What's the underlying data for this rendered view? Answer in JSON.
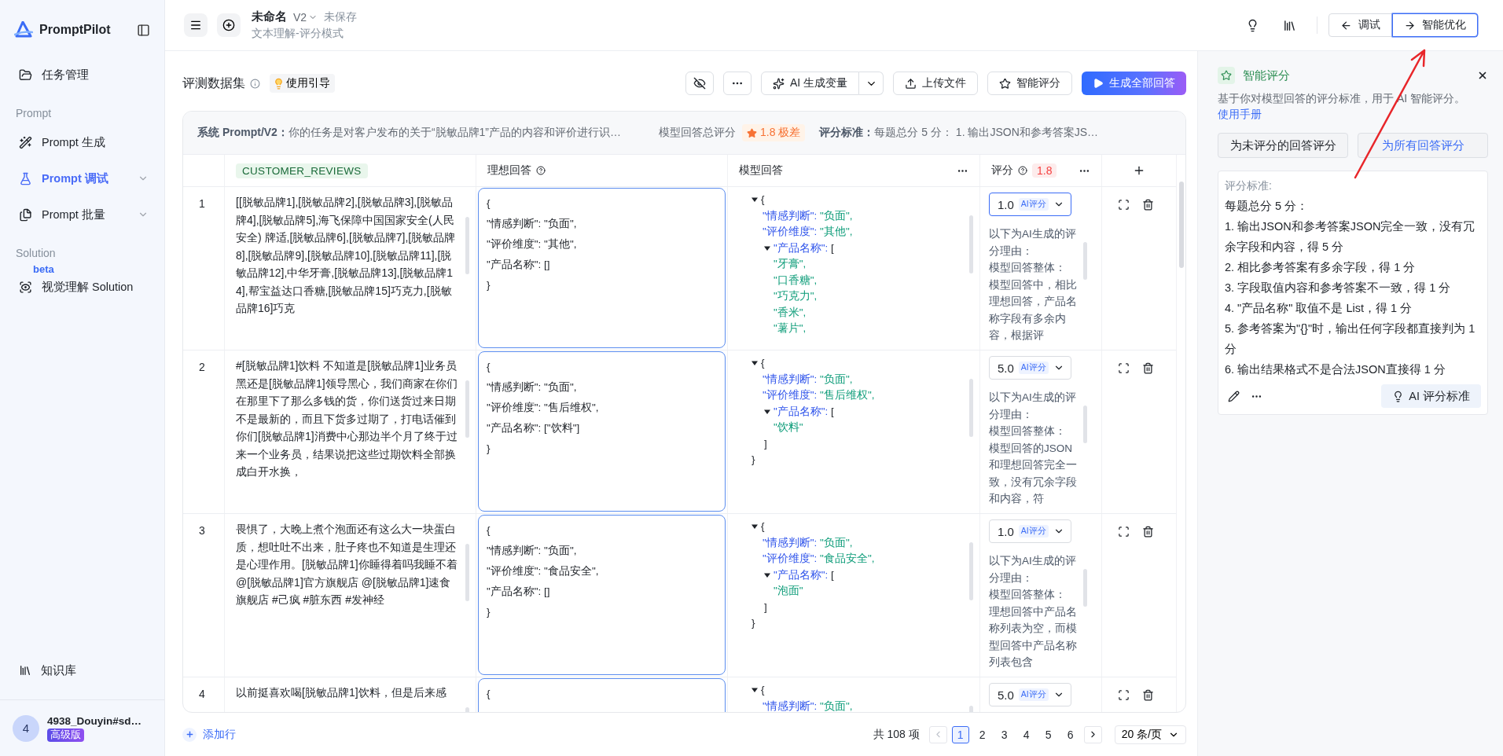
{
  "sidebar": {
    "brand": "PromptPilot",
    "items": [
      {
        "kind": "item",
        "label": "任务管理",
        "selected": false,
        "expandable": false
      },
      {
        "kind": "section",
        "label": "Prompt"
      },
      {
        "kind": "item",
        "label": "Prompt 生成",
        "selected": false,
        "expandable": false
      },
      {
        "kind": "item",
        "label": "Prompt 调试",
        "selected": true,
        "expandable": true
      },
      {
        "kind": "item",
        "label": "Prompt 批量",
        "selected": false,
        "expandable": true
      },
      {
        "kind": "section",
        "label": "Solution"
      },
      {
        "kind": "item",
        "label": "视觉理解 Solution",
        "selected": false,
        "expandable": false,
        "badge": "beta"
      }
    ],
    "footer_item": "知识库",
    "user": {
      "avatar": "4",
      "name": "4938_Douyin#sd…",
      "plan": "高级版"
    }
  },
  "header": {
    "title": "未命名",
    "version": "V2",
    "save_status": "未保存",
    "subtitle": "文本理解-评分模式",
    "modes": [
      {
        "label": "调试",
        "selected": false
      },
      {
        "label": "智能优化",
        "selected": true
      }
    ]
  },
  "dataset": {
    "title": "评测数据集",
    "guide": "使用引导",
    "buttons": [
      {
        "label": "AI 生成变量",
        "kind": "split"
      },
      {
        "label": "上传文件",
        "kind": "upload"
      },
      {
        "label": "智能评分",
        "kind": "star"
      },
      {
        "label": "生成全部回答",
        "kind": "primary"
      }
    ]
  },
  "summary": {
    "prompt_label": "系统 Prompt/V2：",
    "prompt_text": "你的任务是对客户发布的关于“脱敏品牌1”产品的内容和评价进行识…",
    "score_label": "模型回答总评分",
    "score_badge": "1.8 极差",
    "criteria_label": "评分标准：",
    "criteria_text": "每题总分 5 分：  1. 输出JSON和参考答案JS…"
  },
  "columns": [
    {
      "kind": "variable",
      "label": "CUSTOMER_REVIEWS"
    },
    {
      "kind": "help",
      "label": "理想回答"
    },
    {
      "kind": "menu",
      "label": "模型回答"
    },
    {
      "kind": "score",
      "label": "评分",
      "badge": "1.8"
    }
  ],
  "rows": [
    {
      "index": "1",
      "review": "[[脱敏品牌1],[脱敏品牌2],[脱敏品牌3],[脱敏品牌4],[脱敏品牌5],海飞保障中国国家安全(人民安全) 牌适,[脱敏品牌6],[脱敏品牌7],[脱敏品牌8],[脱敏品牌9],[脱敏品牌10],[脱敏品牌11],[脱敏品牌12],中华牙膏,[脱敏品牌13],[脱敏品牌14],帮宝益达口香糖,[脱敏品牌15]巧克力,[脱敏品牌16]巧克",
      "ideal": [
        "{",
        "\"情感判断\": \"负面\",",
        "\"评价维度\": \"其他\",",
        "\"产品名称\": []",
        "}"
      ],
      "model": [
        {
          "kind": "open",
          "text": "{"
        },
        {
          "kind": "pair",
          "key": "\"情感判断\":",
          "value": " \"负面\","
        },
        {
          "kind": "pair",
          "key": "\"评价维度\":",
          "value": " \"其他\","
        },
        {
          "kind": "list",
          "key": "\"产品名称\":",
          "value": " ["
        },
        {
          "kind": "item",
          "text": "\"牙膏\","
        },
        {
          "kind": "item",
          "text": "\"口香糖\","
        },
        {
          "kind": "item",
          "text": "\"巧克力\","
        },
        {
          "kind": "item",
          "text": "\"香米\","
        },
        {
          "kind": "item",
          "text": "\"薯片\","
        }
      ],
      "score": "1.0",
      "score_tag": "AI评分",
      "active": true,
      "reason": [
        "以下为AI生成的评分理由：",
        "模型回答整体：",
        "模型回答中，相比理想回答，产品名称字段有多余内容，根据评"
      ]
    },
    {
      "index": "2",
      "review": "#[脱敏品牌1]饮料 不知道是[脱敏品牌1]业务员黑还是[脱敏品牌1]领导黑心，我们商家在你们在那里下了那么多钱的货，你们送货过来日期不是最新的，而且下货多过期了，打电话催到你们[脱敏品牌1]消费中心那边半个月了终于过来一个业务员，结果说把这些过期饮料全部换成白开水换，",
      "ideal": [
        "{",
        "\"情感判断\": \"负面\",",
        "\"评价维度\": \"售后维权\",",
        "\"产品名称\": [\"饮料\"]",
        "}"
      ],
      "model": [
        {
          "kind": "open",
          "text": "{"
        },
        {
          "kind": "pair",
          "key": "\"情感判断\":",
          "value": " \"负面\","
        },
        {
          "kind": "pair",
          "key": "\"评价维度\":",
          "value": " \"售后维权\","
        },
        {
          "kind": "list",
          "key": "\"产品名称\":",
          "value": " ["
        },
        {
          "kind": "item",
          "text": "\"饮料\""
        },
        {
          "kind": "end",
          "text": "]"
        },
        {
          "kind": "close",
          "text": "}"
        }
      ],
      "score": "5.0",
      "score_tag": "AI评分",
      "active": false,
      "reason": [
        "以下为AI生成的评分理由：",
        "模型回答整体：",
        "模型回答的JSON和理想回答完全一致，没有冗余字段和内容，符"
      ]
    },
    {
      "index": "3",
      "review": "畏惧了，大晚上煮个泡面还有这么大一块蛋白质，想吐吐不出来，肚子疼也不知道是生理还是心理作用。[脱敏品牌1]你睡得着吗我睡不着 @[脱敏品牌1]官方旗舰店 @[脱敏品牌1]速食旗舰店 #己疯 #脏东西 #发神经",
      "ideal": [
        "{",
        "\"情感判断\": \"负面\",",
        "\"评价维度\": \"食品安全\",",
        "\"产品名称\": []",
        "}"
      ],
      "model": [
        {
          "kind": "open",
          "text": "{"
        },
        {
          "kind": "pair",
          "key": "\"情感判断\":",
          "value": " \"负面\","
        },
        {
          "kind": "pair",
          "key": "\"评价维度\":",
          "value": " \"食品安全\","
        },
        {
          "kind": "list",
          "key": "\"产品名称\":",
          "value": " ["
        },
        {
          "kind": "item",
          "text": "\"泡面\""
        },
        {
          "kind": "end",
          "text": "]"
        },
        {
          "kind": "close",
          "text": "}"
        }
      ],
      "score": "1.0",
      "score_tag": "AI评分",
      "active": false,
      "reason": [
        "以下为AI生成的评分理由：",
        "模型回答整体：",
        "理想回答中产品名称列表为空，而模型回答中产品名称列表包含"
      ]
    },
    {
      "index": "4",
      "review": "以前挺喜欢喝[脱敏品牌1]饮料，但是后来感",
      "ideal": [
        "{"
      ],
      "model": [
        {
          "kind": "open",
          "text": "{"
        },
        {
          "kind": "pair",
          "key": "\"情感判断\":",
          "value": " \"负面\","
        }
      ],
      "score": "5.0",
      "score_tag": "AI评分",
      "active": false
    }
  ],
  "footer": {
    "add_row": "添加行",
    "total": "共 108 项",
    "pages": [
      {
        "label": "1",
        "selected": true
      },
      {
        "label": "2",
        "selected": false
      },
      {
        "label": "3",
        "selected": false
      },
      {
        "label": "4",
        "selected": false
      },
      {
        "label": "5",
        "selected": false
      },
      {
        "label": "6",
        "selected": false
      }
    ],
    "page_size": "20 条/页"
  },
  "panel": {
    "title": "智能评分",
    "description": "基于你对模型回答的评分标准，用于 AI 智能评分。",
    "manual_link": "使用手册",
    "buttons": [
      {
        "label": "为未评分的回答评分",
        "kind": "default"
      },
      {
        "label": "为所有回答评分",
        "kind": "link"
      }
    ],
    "criteria_heading": "评分标准:",
    "criteria": [
      "每题总分 5 分：",
      "1. 输出JSON和参考答案JSON完全一致，没有冗余字段和内容，得 5 分",
      "2. 相比参考答案有多余字段，得 1 分",
      "3. 字段取值内容和参考答案不一致，得 1 分",
      "4. \"产品名称\" 取值不是 List，得 1 分",
      "5. 参考答案为\"{}\"时，输出任何字段都直接判为 1 分",
      "6. 输出结果格式不是合法JSON直接得 1 分"
    ],
    "ai_button": "AI 评分标准"
  }
}
